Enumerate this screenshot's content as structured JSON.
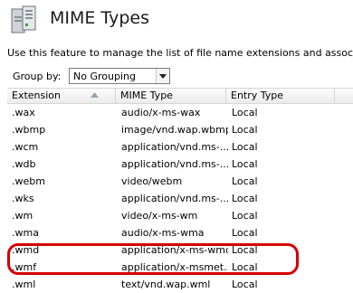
{
  "header": {
    "icon": "server-icon",
    "title": "MIME Types"
  },
  "description": "Use this feature to manage the list of file name extensions and associated cont",
  "group_by": {
    "label": "Group by:",
    "value": "No Grouping"
  },
  "table": {
    "columns": [
      "Extension",
      "MIME Type",
      "Entry Type"
    ],
    "sorted_column": "Extension",
    "rows": [
      {
        "ext": ".wax",
        "mime": "audio/x-ms-wax",
        "entry": "Local"
      },
      {
        "ext": ".wbmp",
        "mime": "image/vnd.wap.wbmp",
        "entry": "Local"
      },
      {
        "ext": ".wcm",
        "mime": "application/vnd.ms-...",
        "entry": "Local"
      },
      {
        "ext": ".wdb",
        "mime": "application/vnd.ms-...",
        "entry": "Local"
      },
      {
        "ext": ".webm",
        "mime": "video/webm",
        "entry": "Local"
      },
      {
        "ext": ".wks",
        "mime": "application/vnd.ms-...",
        "entry": "Local"
      },
      {
        "ext": ".wm",
        "mime": "video/x-ms-wm",
        "entry": "Local"
      },
      {
        "ext": ".wma",
        "mime": "audio/x-ms-wma",
        "entry": "Local"
      },
      {
        "ext": ".wmd",
        "mime": "application/x-ms-wmd",
        "entry": "Local"
      },
      {
        "ext": ".wmf",
        "mime": "application/x-msmet...",
        "entry": "Local"
      },
      {
        "ext": ".wml",
        "mime": "text/vnd.wap.wml",
        "entry": "Local"
      }
    ],
    "highlighted_row": ".webm",
    "highlight_color": "#d40000"
  }
}
